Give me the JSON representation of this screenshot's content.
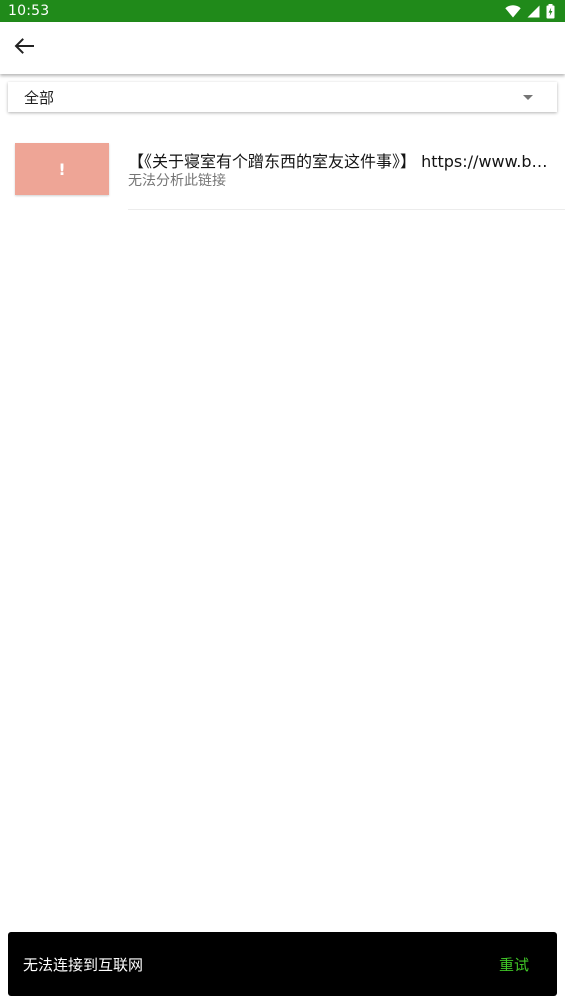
{
  "status_bar": {
    "time": "10:53",
    "icons": [
      "wifi-icon",
      "signal-icon",
      "battery-charging-icon"
    ],
    "background_color": "#208a1a"
  },
  "app_bar": {
    "back_icon": "arrow-left-icon"
  },
  "filter": {
    "selected": "全部",
    "icon": "dropdown-arrow-icon"
  },
  "items": [
    {
      "thumbnail_glyph": "!",
      "thumbnail_color": "#eea596",
      "title": "【《关于寝室有个蹭东西的室友这件事》】 https://www.bilibili.com",
      "subtitle": "无法分析此链接"
    }
  ],
  "snackbar": {
    "message": "无法连接到互联网",
    "action": "重试",
    "action_color": "#3fc427"
  }
}
